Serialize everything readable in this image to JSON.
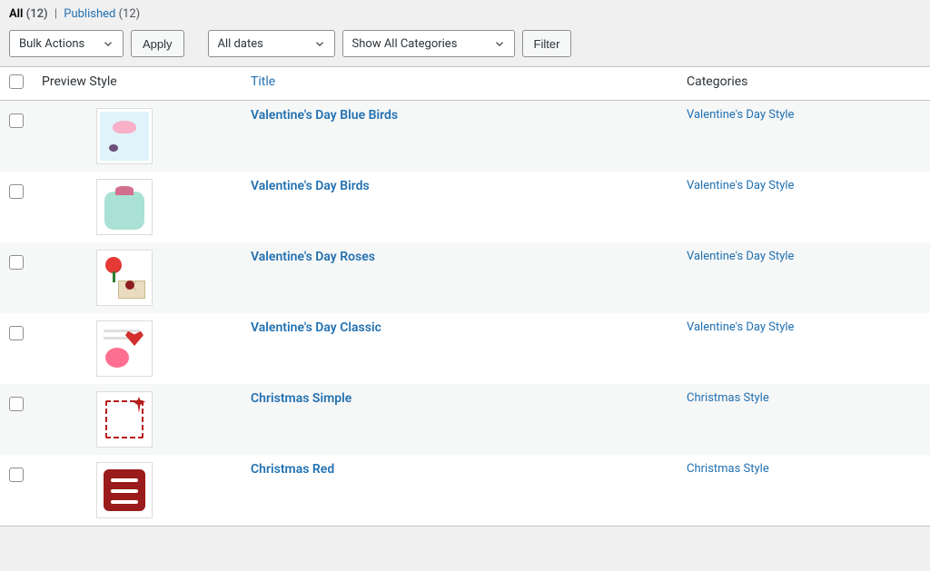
{
  "filters": {
    "all_label": "All",
    "all_count": "(12)",
    "published_label": "Published",
    "published_count": "(12)"
  },
  "toolbar": {
    "bulk_actions": "Bulk Actions",
    "apply": "Apply",
    "all_dates": "All dates",
    "show_all_categories": "Show All Categories",
    "filter": "Filter"
  },
  "columns": {
    "preview": "Preview Style",
    "title": "Title",
    "categories": "Categories"
  },
  "rows": [
    {
      "title": "Valentine's Day Blue Birds",
      "category": "Valentine's Day Style",
      "thumb": "bluebirds"
    },
    {
      "title": "Valentine's Day Birds",
      "category": "Valentine's Day Style",
      "thumb": "birds"
    },
    {
      "title": "Valentine's Day Roses",
      "category": "Valentine's Day Style",
      "thumb": "roses"
    },
    {
      "title": "Valentine's Day Classic",
      "category": "Valentine's Day Style",
      "thumb": "classic"
    },
    {
      "title": "Christmas Simple",
      "category": "Christmas Style",
      "thumb": "xsimple"
    },
    {
      "title": "Christmas Red",
      "category": "Christmas Style",
      "thumb": "xred"
    }
  ]
}
